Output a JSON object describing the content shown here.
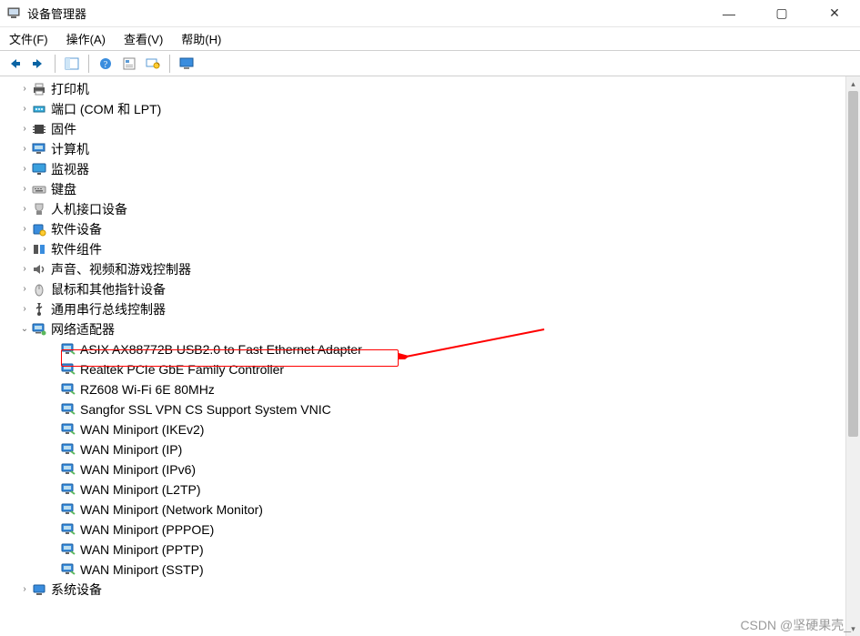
{
  "window": {
    "title": "设备管理器",
    "controls": {
      "minimize": "—",
      "maximize": "▢",
      "close": "✕"
    }
  },
  "menu": {
    "items": [
      {
        "label": "文件(F)"
      },
      {
        "label": "操作(A)"
      },
      {
        "label": "查看(V)"
      },
      {
        "label": "帮助(H)"
      }
    ]
  },
  "toolbar": {
    "buttons": [
      {
        "name": "back",
        "title": "后退"
      },
      {
        "name": "forward",
        "title": "前进"
      },
      {
        "name": "show-hide",
        "title": "显示/隐藏控制台树"
      },
      {
        "name": "help",
        "title": "帮助"
      },
      {
        "name": "properties",
        "title": "属性"
      },
      {
        "name": "scan",
        "title": "扫描检测硬件改动"
      },
      {
        "name": "monitor",
        "title": "查看"
      }
    ]
  },
  "tree": {
    "categories": [
      {
        "icon": "printer",
        "label": "打印机",
        "expanded": false
      },
      {
        "icon": "port",
        "label": "端口 (COM 和 LPT)",
        "expanded": false
      },
      {
        "icon": "firmware",
        "label": "固件",
        "expanded": false
      },
      {
        "icon": "computer",
        "label": "计算机",
        "expanded": false
      },
      {
        "icon": "monitor",
        "label": "监视器",
        "expanded": false
      },
      {
        "icon": "keyboard",
        "label": "键盘",
        "expanded": false
      },
      {
        "icon": "hid",
        "label": "人机接口设备",
        "expanded": false
      },
      {
        "icon": "software-device",
        "label": "软件设备",
        "expanded": false
      },
      {
        "icon": "software-component",
        "label": "软件组件",
        "expanded": false
      },
      {
        "icon": "sound",
        "label": "声音、视频和游戏控制器",
        "expanded": false
      },
      {
        "icon": "mouse",
        "label": "鼠标和其他指针设备",
        "expanded": false
      },
      {
        "icon": "usb",
        "label": "通用串行总线控制器",
        "expanded": false
      },
      {
        "icon": "network",
        "label": "网络适配器",
        "expanded": true,
        "children": [
          {
            "icon": "network-adapter",
            "label": "ASIX AX88772B USB2.0 to Fast Ethernet Adapter",
            "highlighted": true
          },
          {
            "icon": "network-adapter",
            "label": "Realtek PCIe GbE Family Controller"
          },
          {
            "icon": "network-adapter",
            "label": "RZ608 Wi-Fi 6E 80MHz"
          },
          {
            "icon": "network-adapter",
            "label": "Sangfor SSL VPN CS Support System VNIC"
          },
          {
            "icon": "network-adapter",
            "label": "WAN Miniport (IKEv2)"
          },
          {
            "icon": "network-adapter",
            "label": "WAN Miniport (IP)"
          },
          {
            "icon": "network-adapter",
            "label": "WAN Miniport (IPv6)"
          },
          {
            "icon": "network-adapter",
            "label": "WAN Miniport (L2TP)"
          },
          {
            "icon": "network-adapter",
            "label": "WAN Miniport (Network Monitor)"
          },
          {
            "icon": "network-adapter",
            "label": "WAN Miniport (PPPOE)"
          },
          {
            "icon": "network-adapter",
            "label": "WAN Miniport (PPTP)"
          },
          {
            "icon": "network-adapter",
            "label": "WAN Miniport (SSTP)"
          }
        ]
      },
      {
        "icon": "system-device",
        "label": "系统设备",
        "expanded": false
      }
    ]
  },
  "watermark": "CSDN @坚硬果壳_"
}
